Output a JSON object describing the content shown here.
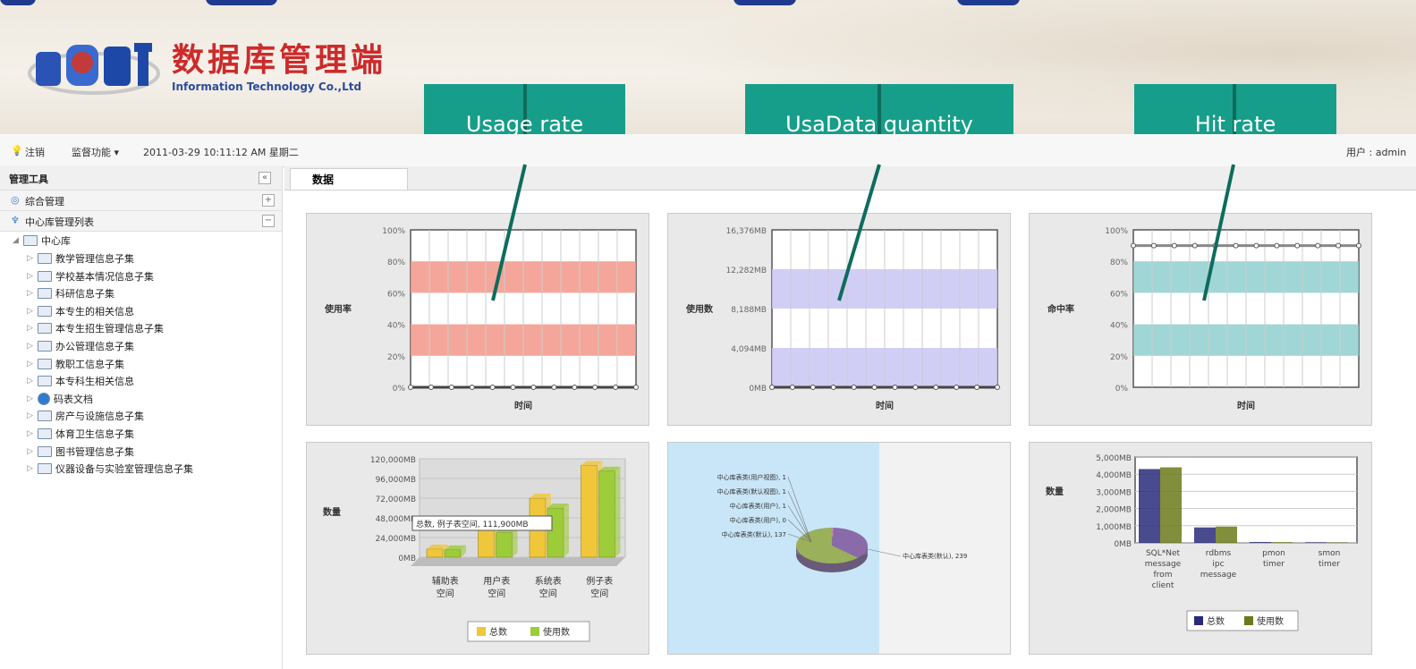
{
  "header": {
    "logo_text": "数据库管理端",
    "company": "Information Technology Co.,Ltd"
  },
  "callouts": [
    {
      "label": "Usage rate"
    },
    {
      "label": "UsaData quantity"
    },
    {
      "label": "Hit rate"
    }
  ],
  "toolbar": {
    "logout": "注销",
    "monitor": "监督功能",
    "datetime": "2011-03-29 10:11:12 AM 星期二",
    "user": "用户 : admin"
  },
  "sidebar": {
    "title": "管理工具",
    "sections": [
      {
        "label": "综合管理"
      },
      {
        "label": "中心库管理列表"
      }
    ],
    "root": "中心库",
    "items": [
      {
        "label": "教学管理信息子集"
      },
      {
        "label": "学校基本情况信息子集"
      },
      {
        "label": "科研信息子集"
      },
      {
        "label": "本专生的相关信息"
      },
      {
        "label": "本专生招生管理信息子集"
      },
      {
        "label": "办公管理信息子集"
      },
      {
        "label": "教职工信息子集"
      },
      {
        "label": "本专科生相关信息"
      },
      {
        "label": "码表文档"
      },
      {
        "label": "房产与设施信息子集"
      },
      {
        "label": "体育卫生信息子集"
      },
      {
        "label": "图书管理信息子集"
      },
      {
        "label": "仪器设备与实验室管理信息子集"
      }
    ]
  },
  "content": {
    "tab": "数据"
  },
  "chart_data": [
    {
      "type": "line",
      "ylabel": "使用率",
      "xlabel": "时间",
      "yticks": [
        "100%",
        "80%",
        "60%",
        "40%",
        "20%",
        "0%"
      ],
      "ylim": [
        0,
        100
      ],
      "series": [
        {
          "values": [
            0,
            0,
            0,
            0,
            0,
            0,
            0,
            0,
            0,
            0,
            0,
            0
          ]
        }
      ],
      "band_color": "#f3978a",
      "line_color": "#444444"
    },
    {
      "type": "line",
      "ylabel": "使用数",
      "xlabel": "时间",
      "yticks": [
        "16,376MB",
        "12,282MB",
        "8,188MB",
        "4,094MB",
        "0MB"
      ],
      "ylim": [
        0,
        16376
      ],
      "series": [
        {
          "values": [
            0,
            0,
            0,
            0,
            0,
            0,
            0,
            0,
            0,
            0,
            0,
            0
          ]
        }
      ],
      "band_color": "#c9c6f5",
      "line_color": "#444444"
    },
    {
      "type": "line",
      "ylabel": "命中率",
      "xlabel": "时间",
      "yticks": [
        "100%",
        "80%",
        "60%",
        "40%",
        "20%",
        "0%"
      ],
      "ylim": [
        0,
        100
      ],
      "series": [
        {
          "values": [
            90,
            90,
            90,
            90,
            90,
            90,
            90,
            90,
            90,
            90,
            90,
            90
          ]
        }
      ],
      "band_color": "#8fcfcf",
      "line_color": "#888888"
    },
    {
      "type": "bar",
      "ylabel": "数量",
      "yticks": [
        "120,000MB",
        "96,000MB",
        "72,000MB",
        "48,000MB",
        "24,000MB",
        "0MB"
      ],
      "ylim": [
        0,
        120000
      ],
      "categories": [
        "辅助表空间",
        "用户表空间",
        "系统表空间",
        "例子表空间"
      ],
      "series": [
        {
          "name": "总数",
          "values": [
            10000,
            35000,
            72000,
            111900
          ]
        },
        {
          "name": "使用数",
          "values": [
            9000,
            30000,
            60000,
            105000
          ]
        }
      ],
      "tooltip": "总数, 例子表空间, 111,900MB",
      "colors": [
        "#f0c63a",
        "#9ccc3a"
      ]
    },
    {
      "type": "pie",
      "labels": [
        "中心库表类(用户视图), 1",
        "中心库表类(默认视图), 1",
        "中心库表类(用户), 1",
        "中心库表类(用户), 0",
        "中心库表类(默认), 137",
        "中心库表类(默认), 239"
      ],
      "values": [
        1,
        1,
        1,
        0,
        137,
        239
      ]
    },
    {
      "type": "bar",
      "ylabel": "数量",
      "yticks": [
        "5,000MB",
        "4,000MB",
        "3,000MB",
        "2,000MB",
        "1,000MB",
        "0MB"
      ],
      "ylim": [
        0,
        5000
      ],
      "categories": [
        "SQL*Net message from client",
        "rdbms ipc message",
        "pmon timer",
        "smon timer"
      ],
      "series": [
        {
          "name": "总数",
          "values": [
            4300,
            900,
            50,
            30
          ]
        },
        {
          "name": "使用数",
          "values": [
            4400,
            950,
            40,
            20
          ]
        }
      ],
      "colors": [
        "#2a2a7a",
        "#6b7a1a"
      ]
    }
  ]
}
